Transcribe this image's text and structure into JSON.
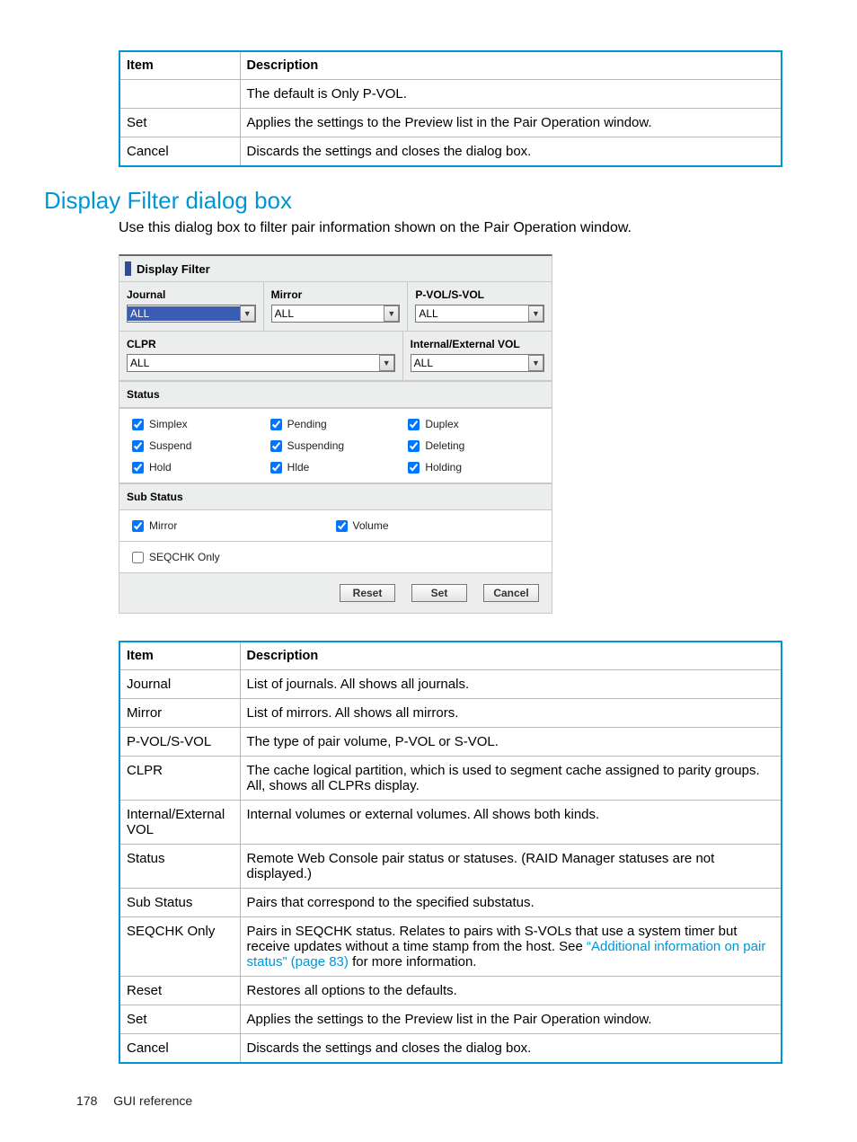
{
  "table1": {
    "headers": [
      "Item",
      "Description"
    ],
    "rows": [
      [
        "",
        "The default is Only P-VOL."
      ],
      [
        "Set",
        "Applies the settings to the Preview list in the Pair Operation window."
      ],
      [
        "Cancel",
        "Discards the settings and closes the dialog box."
      ]
    ]
  },
  "heading": "Display Filter dialog box",
  "intro": "Use this dialog box to filter pair information shown on the Pair Operation window.",
  "dialog": {
    "title": "Display Filter",
    "journal_label": "Journal",
    "mirror_label": "Mirror",
    "pvolsvol_label": "P-VOL/S-VOL",
    "journal_value": "ALL",
    "mirror_value": "ALL",
    "pvolsvol_value": "ALL",
    "clpr_label": "CLPR",
    "intext_label": "Internal/External VOL",
    "clpr_value": "ALL",
    "intext_value": "ALL",
    "status_label": "Status",
    "status_items": [
      "Simplex",
      "Pending",
      "Duplex",
      "Suspend",
      "Suspending",
      "Deleting",
      "Hold",
      "Hlde",
      "Holding"
    ],
    "substatus_label": "Sub Status",
    "substatus_items": [
      "Mirror",
      "Volume"
    ],
    "seqchk_label": "SEQCHK Only",
    "btn_reset": "Reset",
    "btn_set": "Set",
    "btn_cancel": "Cancel"
  },
  "table2": {
    "headers": [
      "Item",
      "Description"
    ],
    "rows": [
      [
        "Journal",
        "List of journals. All shows all journals."
      ],
      [
        "Mirror",
        "List of mirrors. All shows all mirrors."
      ],
      [
        "P-VOL/S-VOL",
        "The type of pair volume, P-VOL or S-VOL."
      ],
      [
        "CLPR",
        "The cache logical partition, which is used to segment cache assigned to parity groups. All, shows all CLPRs display."
      ],
      [
        "Internal/External VOL",
        "Internal volumes or external volumes. All shows both kinds."
      ],
      [
        "Status",
        "Remote Web Console pair status or statuses. (RAID Manager statuses are not displayed.)"
      ],
      [
        "Sub Status",
        "Pairs that correspond to the specified substatus."
      ],
      [
        "SEQCHK Only",
        ""
      ],
      [
        "Reset",
        "Restores all options to the defaults."
      ],
      [
        "Set",
        "Applies the settings to the Preview list in the Pair Operation window."
      ],
      [
        "Cancel",
        "Discards the settings and closes the dialog box."
      ]
    ],
    "seqchk_pre": "Pairs in SEQCHK status. Relates to pairs with S-VOLs that use a system timer but receive updates without a time stamp from the host. See ",
    "seqchk_link": "“Additional information on pair status” (page 83)",
    "seqchk_post": " for more information."
  },
  "footer": {
    "page": "178",
    "section": "GUI reference"
  }
}
